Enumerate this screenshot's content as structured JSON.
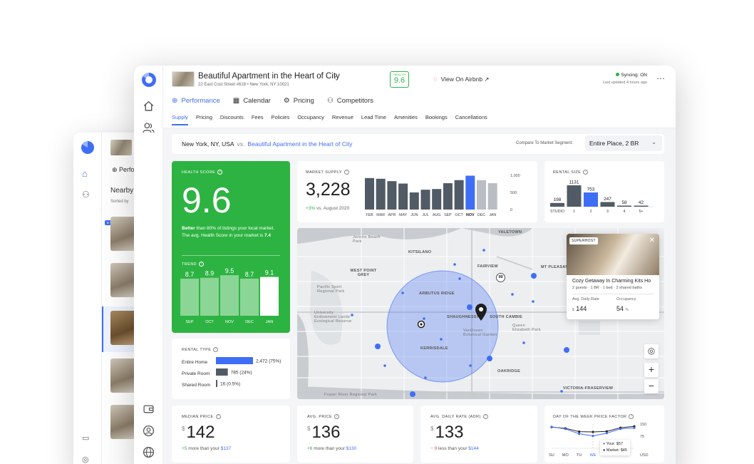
{
  "header": {
    "title": "Beautiful Apartment in the Heart of City",
    "address": "22 East Cost Street #618 • New York, NY 10021",
    "health_badge_label": "HEALTH",
    "health_badge_value": "9.6",
    "airbnb_link": "View On Airbnb ↗",
    "sync_status": "Syncing: ON",
    "last_updated": "Last updated 4 hours ago"
  },
  "tabs": [
    {
      "label": "Performance",
      "icon": "chart-icon"
    },
    {
      "label": "Calendar",
      "icon": "calendar-icon"
    },
    {
      "label": "Pricing",
      "icon": "pricing-icon"
    },
    {
      "label": "Competitors",
      "icon": "competitors-icon"
    }
  ],
  "subtabs": [
    "Supply",
    "Pricing",
    "Discounts",
    "Fees",
    "Policies",
    "Occupancy",
    "Revenue",
    "Lead Time",
    "Amenities",
    "Bookings",
    "Cancellations"
  ],
  "compare": {
    "city": "New York, NY, USA",
    "vs": "vs.",
    "listing": "Beautiful Apartment in the Heart of City",
    "segment_label": "Compare To Market Segment:",
    "segment_value": "Entire Place, 2 BR"
  },
  "health": {
    "label": "HEALTH SCORE",
    "score": "9.6",
    "desc_bold": "Better",
    "desc": " than 80% of listings your local market.  The avg. Health Score in your market is ",
    "avg": "7.4",
    "trend_label": "TREND"
  },
  "supply": {
    "label": "MARKET SUPPLY",
    "value": "3,228",
    "change": "+3%",
    "change_rest": " vs. August 2020"
  },
  "rental_size": {
    "label": "RENTAL SIZE"
  },
  "rental_type": {
    "label": "RENTAL TYPE",
    "rows": [
      {
        "name": "Entire Home",
        "count": "2,472",
        "pct": "(75%)",
        "share": 0.75,
        "color": "#3f6ef6"
      },
      {
        "name": "Private Room",
        "count": "785",
        "pct": "(24%)",
        "share": 0.24,
        "color": "#505b66"
      },
      {
        "name": "Shared Room",
        "count": "16",
        "pct": "(0.5%)",
        "share": 0.005,
        "color": "#505b66"
      }
    ]
  },
  "map": {
    "labels": [
      "YALETOWN",
      "KITSILANO",
      "WEST POINT GREY",
      "FAIRVIEW",
      "MT PLEASANT",
      "ARBUTUS RIDGE",
      "SHAUGHNESSY",
      "SOUTH CAMBIE",
      "KERRISDALE",
      "OAKRIDGE",
      "VICTORIA-FRASERVIEW",
      "Pacific Spirit Regional Park",
      "University Endowment Lands Ecological Reserve",
      "VanDusen Botanical Garden",
      "Queen Elizabeth Park",
      "Jericho Beach Park",
      "Fraser River Regional Park"
    ],
    "route": "99",
    "popup": {
      "badge": "SUPERHOST",
      "title": "Cozy Getaway In Charming Kits Ho",
      "details": "2 guests · 1 BR · 1 bed · 2 shared baths",
      "rate_label": "Avg. Daily Rate",
      "rate_value": "144",
      "rate_cur": "$",
      "occ_label": "Occupancy",
      "occ_value": "54",
      "occ_unit": "%"
    }
  },
  "kpis": [
    {
      "label": "MEDIAN PRICE",
      "cur": "$",
      "value": "142",
      "delta": "+5",
      "delta_type": "g",
      "rest": " more than your ",
      "ref": "$137"
    },
    {
      "label": "AVG. PRICE",
      "cur": "$",
      "value": "136",
      "delta": "+6",
      "delta_type": "g",
      "rest": " more than your ",
      "ref": "$130"
    },
    {
      "label": "AVG. DAILY RATE (ADR)",
      "cur": "$",
      "value": "133",
      "delta": "− 9",
      "delta_type": "r",
      "rest": " less than your ",
      "ref": "$144"
    }
  ],
  "dow": {
    "label": "DAY OF THE WEEK PRICE FACTOR",
    "your": "Your: $57",
    "market": "Market: $45"
  },
  "back_window": {
    "perf": "Perfo",
    "nearby": "Nearby",
    "sorted": "Sorted by",
    "badge": "YOUR LISTI"
  },
  "chart_data": [
    {
      "type": "bar",
      "title": "TREND",
      "categories": [
        "SEP",
        "OCT",
        "NOV",
        "DEC",
        "JAN"
      ],
      "values": [
        8.7,
        8.9,
        9.5,
        8.7,
        9.1
      ],
      "ylim": [
        0,
        10
      ]
    },
    {
      "type": "bar",
      "title": "MARKET SUPPLY",
      "categories": [
        "FEB",
        "MAR",
        "APR",
        "MAY",
        "JUN",
        "JUL",
        "AUG",
        "SEP",
        "OCT",
        "NOV",
        "DEC",
        "JAN"
      ],
      "values": [
        920,
        900,
        830,
        760,
        500,
        580,
        600,
        770,
        860,
        990,
        860,
        770
      ],
      "highlight": "NOV",
      "yticks": [
        "1,000",
        "500",
        "0"
      ],
      "ylim": [
        0,
        1000
      ]
    },
    {
      "type": "bar",
      "title": "RENTAL SIZE",
      "categories": [
        "STUDIO",
        "1",
        "2",
        "3",
        "4",
        "5+"
      ],
      "values": [
        198,
        1131,
        753,
        247,
        58,
        42
      ],
      "highlight": "2"
    },
    {
      "type": "line",
      "title": "DAY OF THE WEEK PRICE FACTOR",
      "categories": [
        "SU",
        "MO",
        "TU",
        "WE",
        "TH",
        "FR",
        "SA"
      ],
      "series": [
        {
          "values": [
            140,
            132,
            110,
            108,
            112,
            136,
            145
          ]
        },
        {
          "values": [
            142,
            128,
            96,
            82,
            100,
            128,
            135
          ]
        }
      ],
      "yticks": [
        "150",
        "75",
        "USD"
      ],
      "ylim": [
        0,
        160
      ]
    }
  ],
  "colors": {
    "accent": "#3f6ef6",
    "health": "#2db342",
    "bar_dark": "#505b66",
    "bar_light": "#b9bec4"
  }
}
